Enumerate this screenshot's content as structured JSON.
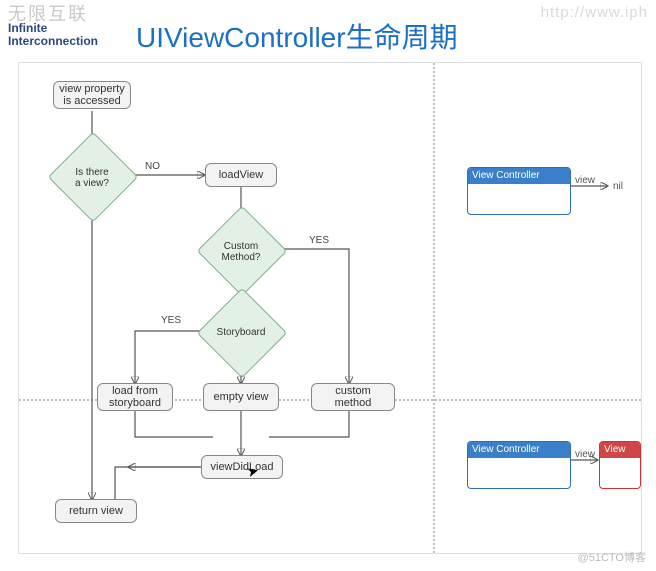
{
  "header": {
    "logo": "无限互联",
    "sub1": "Infinite",
    "sub2": "Interconnection",
    "url": "http://www.iph",
    "title": "UIViewController生命周期"
  },
  "flow": {
    "start": "view property\nis accessed",
    "d1": "Is there\na view?",
    "d1_no": "NO",
    "loadView": "loadView",
    "d2": "Custom\nMethod?",
    "d2_yes": "YES",
    "d3": "Storyboard",
    "d3_yes": "YES",
    "loadSB": "load from\nstoryboard",
    "empty": "empty view",
    "custom": "custom method",
    "didload": "viewDidLoad",
    "ret": "return view"
  },
  "right": {
    "vc": "View Controller",
    "view": "View",
    "viewlbl": "view",
    "nil": "nil"
  },
  "watermark": "@51CTO博客"
}
